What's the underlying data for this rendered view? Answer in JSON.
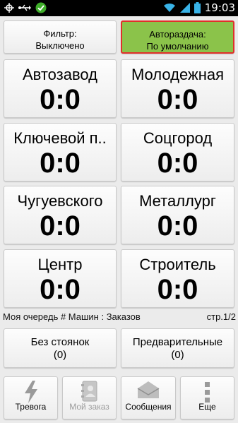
{
  "status_bar": {
    "time": "19:03",
    "icons": [
      "target-icon",
      "usb-icon",
      "check-circle-icon",
      "wifi-icon",
      "signal-icon",
      "battery-icon"
    ]
  },
  "filter": {
    "label": "Фильтр:",
    "value": "Выключено"
  },
  "auto_dispatch": {
    "label": "Автораздача:",
    "value": "По умолчанию",
    "bg_color": "#8bc34a",
    "border_color": "#e0302a"
  },
  "districts": [
    {
      "name": "Автозавод",
      "score": "0:0"
    },
    {
      "name": "Молодежная",
      "score": "0:0"
    },
    {
      "name": "Ключевой п..",
      "score": "0:0"
    },
    {
      "name": "Соцгород",
      "score": "0:0"
    },
    {
      "name": "Чугуевского",
      "score": "0:0"
    },
    {
      "name": "Металлург",
      "score": "0:0"
    },
    {
      "name": "Центр",
      "score": "0:0"
    },
    {
      "name": "Строитель",
      "score": "0:0"
    }
  ],
  "queue": {
    "label": "Моя очередь # Машин : Заказов",
    "page": "стр.1/2"
  },
  "queue_buttons": [
    {
      "label": "Без стоянок",
      "count": "(0)"
    },
    {
      "label": "Предварительные",
      "count": "(0)"
    }
  ],
  "bottom_bar": [
    {
      "label": "Тревога",
      "icon": "lightning-icon",
      "enabled": true
    },
    {
      "label": "Мой заказ",
      "icon": "contacts-book-icon",
      "enabled": false
    },
    {
      "label": "Сообщения",
      "icon": "envelope-icon",
      "enabled": true
    },
    {
      "label": "Еще",
      "icon": "more-vertical-icon",
      "enabled": true
    }
  ]
}
